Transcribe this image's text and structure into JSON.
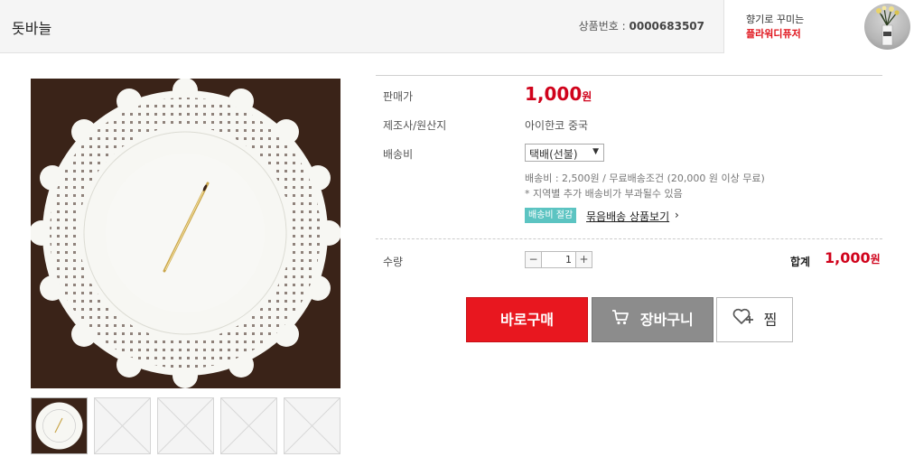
{
  "header": {
    "title": "돗바늘",
    "product_no_label": "상품번호 :",
    "product_no": "0000683507"
  },
  "promo": {
    "line1": "향기로 꾸미는",
    "line2": "플라워디퓨저"
  },
  "info": {
    "price_label": "판매가",
    "price_value": "1,000",
    "price_unit": "원",
    "maker_label": "제조사/원산지",
    "maker_value": "아이한코 중국",
    "shipping_label": "배송비",
    "shipping_select": "택배(선불)",
    "shipping_detail": "배송비 : 2,500원 / 무료배송조건 (20,000 원 이상 무료)",
    "shipping_note": "* 지역별 추가 배송비가 부과될수 있음",
    "badge": "배송비 절감",
    "bundle_link": "묶음배송 상품보기",
    "quantity_label": "수량",
    "quantity_value": "1",
    "total_label": "합계",
    "total_value": "1,000",
    "total_unit": "원"
  },
  "buttons": {
    "buy": "바로구매",
    "cart": "장바구니",
    "wish": "찜"
  },
  "icons": {
    "minus": "−",
    "plus": "+",
    "chevron": "›",
    "dropdown": "▼"
  },
  "colors": {
    "price": "#d0021b",
    "buy_button": "#e8171f",
    "cart_button": "#8c8c8c",
    "badge": "#5cc4c2"
  }
}
